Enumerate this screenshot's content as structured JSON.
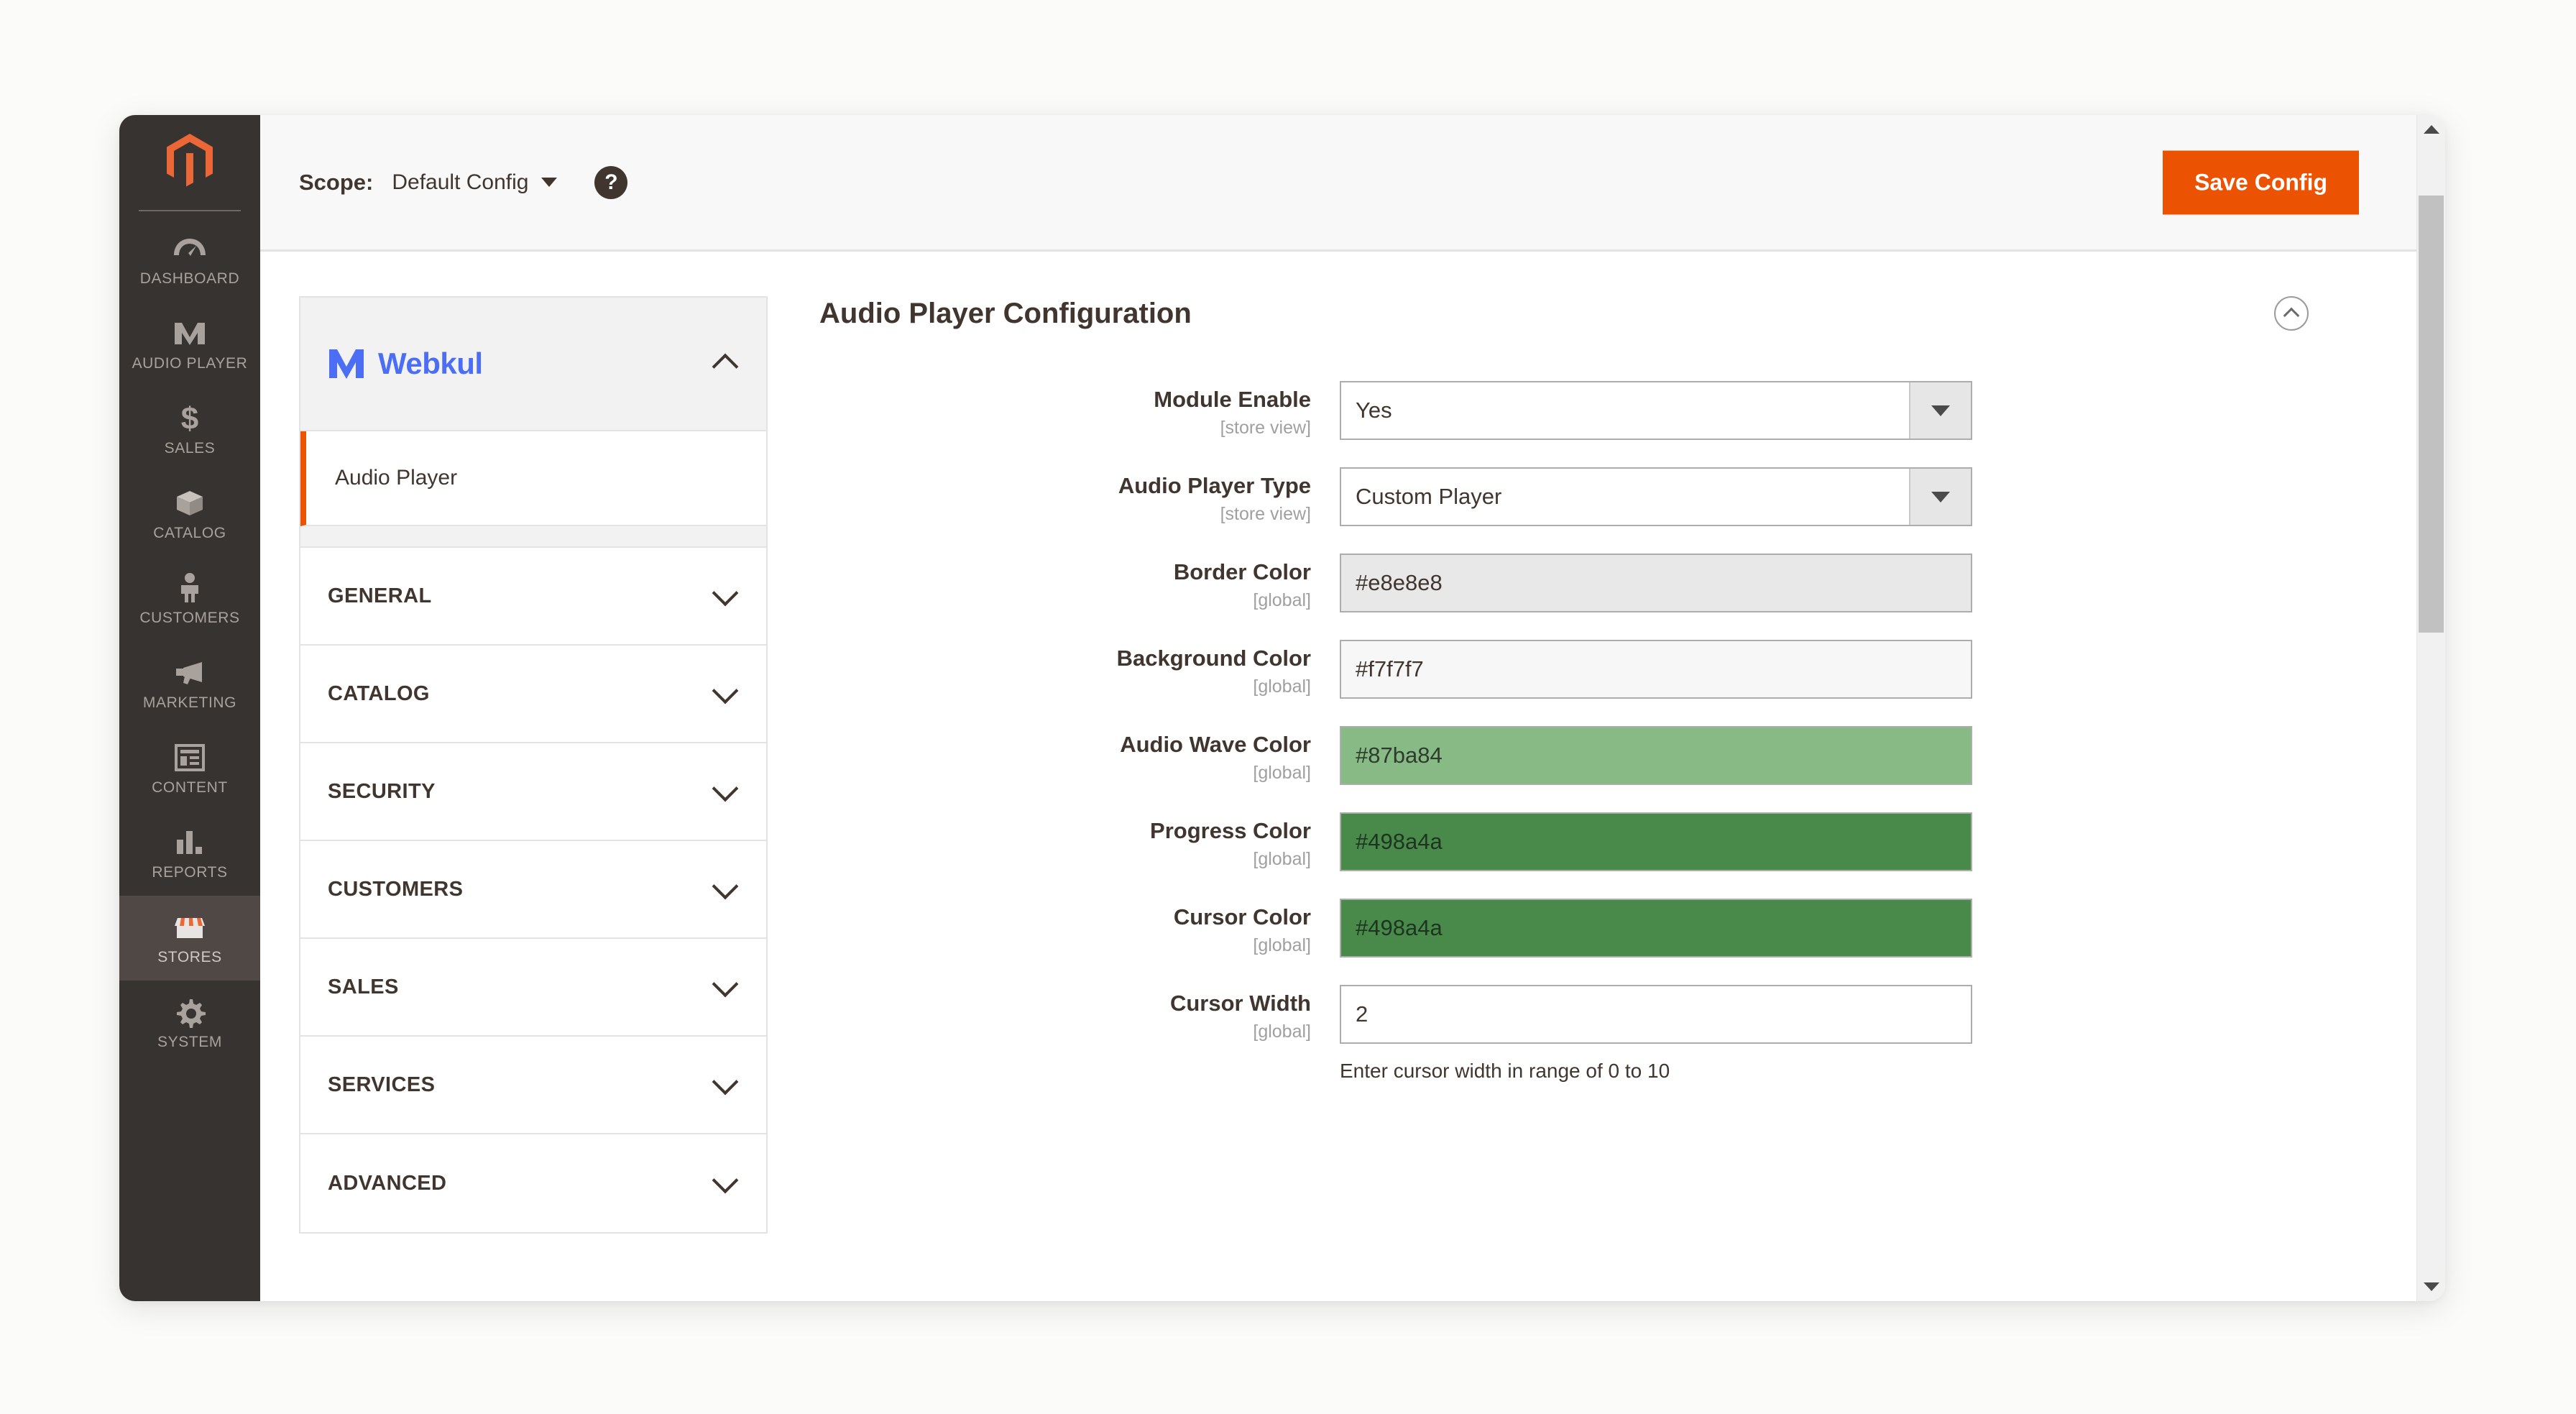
{
  "admin_sidebar": {
    "logo": "magento-logo",
    "items": [
      {
        "label": "DASHBOARD",
        "icon": "dashboard-gauge-icon",
        "active": false
      },
      {
        "label": "AUDIO PLAYER",
        "icon": "webkul-w-icon",
        "active": false
      },
      {
        "label": "SALES",
        "icon": "dollar-sign-icon",
        "active": false
      },
      {
        "label": "CATALOG",
        "icon": "box-icon",
        "active": false
      },
      {
        "label": "CUSTOMERS",
        "icon": "person-icon",
        "active": false
      },
      {
        "label": "MARKETING",
        "icon": "megaphone-icon",
        "active": false
      },
      {
        "label": "CONTENT",
        "icon": "layout-page-icon",
        "active": false
      },
      {
        "label": "REPORTS",
        "icon": "bar-chart-icon",
        "active": false
      },
      {
        "label": "STORES",
        "icon": "storefront-icon",
        "active": true
      },
      {
        "label": "SYSTEM",
        "icon": "gear-icon",
        "active": false
      }
    ]
  },
  "header": {
    "scope_label": "Scope:",
    "scope_value": "Default Config",
    "help_glyph": "?",
    "save_label": "Save Config",
    "save_color": "#eb5202"
  },
  "config_nav": {
    "brand": "Webkul",
    "brand_color": "#4c6ef5",
    "active_item": "Audio Player",
    "sections": [
      {
        "label": "GENERAL"
      },
      {
        "label": "CATALOG"
      },
      {
        "label": "SECURITY"
      },
      {
        "label": "CUSTOMERS"
      },
      {
        "label": "SALES"
      },
      {
        "label": "SERVICES"
      },
      {
        "label": "ADVANCED"
      }
    ]
  },
  "main": {
    "section_title": "Audio Player Configuration",
    "fields": [
      {
        "label": "Module Enable",
        "scope": "[store view]",
        "type": "select",
        "value": "Yes"
      },
      {
        "label": "Audio Player Type",
        "scope": "[store view]",
        "type": "select",
        "value": "Custom Player"
      },
      {
        "label": "Border Color",
        "scope": "[global]",
        "type": "color",
        "value": "#e8e8e8",
        "swatch": "#e8e8e8",
        "text_color": "#41362f"
      },
      {
        "label": "Background Color",
        "scope": "[global]",
        "type": "color",
        "value": "#f7f7f7",
        "swatch": "#f7f7f7",
        "text_color": "#41362f"
      },
      {
        "label": "Audio Wave Color",
        "scope": "[global]",
        "type": "color",
        "value": "#87ba84",
        "swatch": "#87ba84",
        "text_color": "#2f3b2f"
      },
      {
        "label": "Progress Color",
        "scope": "[global]",
        "type": "color",
        "value": "#498a4a",
        "swatch": "#498a4a",
        "text_color": "#1d3520"
      },
      {
        "label": "Cursor Color",
        "scope": "[global]",
        "type": "color",
        "value": "#498a4a",
        "swatch": "#498a4a",
        "text_color": "#1d3520"
      },
      {
        "label": "Cursor Width",
        "scope": "[global]",
        "type": "text",
        "value": "2",
        "hint": "Enter cursor width in range of 0 to 10"
      }
    ]
  }
}
